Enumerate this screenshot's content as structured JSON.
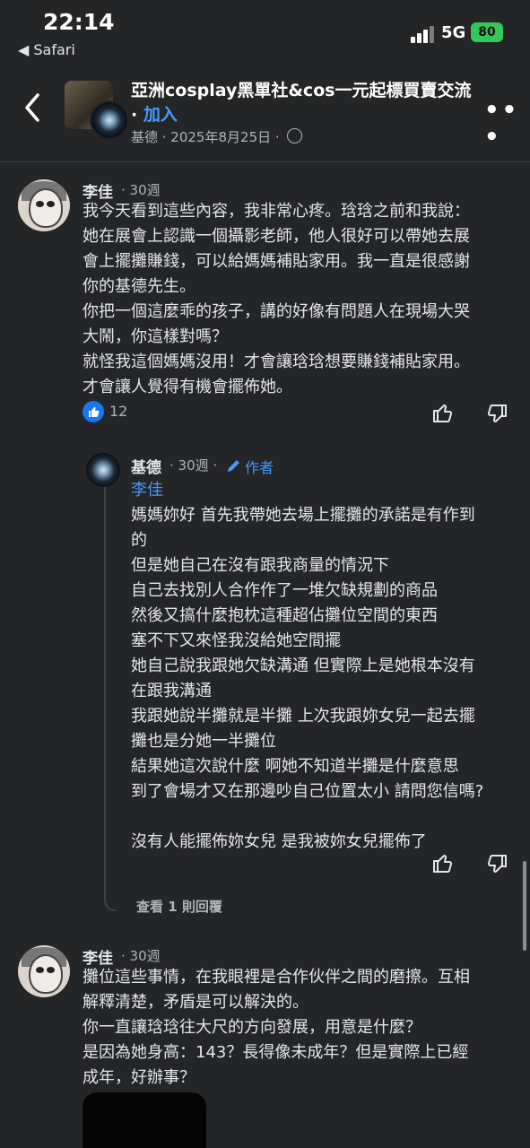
{
  "status": {
    "time": "22:14",
    "back_app": "◀ Safari",
    "network": "5G",
    "battery": "80"
  },
  "header": {
    "title": "亞洲cosplay黑單社&cos一元起標買賣交流",
    "separator": " · ",
    "join": "加入",
    "meta": "基德 · 2025年8月25日 · "
  },
  "comments": [
    {
      "name": "李佳",
      "time": "· 30週",
      "body": "我今天看到這些內容，我非常心疼。琀琀之前和我說：\n她在展會上認識一個攝影老師，他人很好可以帶她去展\n會上擺攤賺錢，可以給媽媽補貼家用。我一直是很感謝\n你的基德先生。\n你把一個這麼乖的孩子，講的好像有問題人在現場大哭\n大鬧，你這樣對嗎？\n就怪我這個媽媽沒用！才會讓琀琀想要賺錢補貼家用。\n才會讓人覺得有機會擺佈她。",
      "likes": "12"
    },
    {
      "name": "基德",
      "time": "· 30週 ·",
      "author_tag": "作者",
      "mention": "李佳",
      "body": "媽媽妳好 首先我帶她去場上擺攤的承諾是有作到\n的\n但是她自己在沒有跟我商量的情況下\n自己去找別人合作作了一堆欠缺規劃的商品\n然後又搞什麼抱枕這種超佔攤位空間的東西\n塞不下又來怪我沒給她空間擺\n她自己說我跟她欠缺溝通 但實際上是她根本沒有\n在跟我溝通\n我跟她說半攤就是半攤 上次我跟妳女兒一起去擺\n攤也是分她一半攤位\n結果她這次說什麼 啊她不知道半攤是什麼意思\n到了會場才又在那邊吵自己位置太小 請問您信嗎?\n\n沒有人能擺佈妳女兒 是我被妳女兒擺佈了"
    },
    {
      "name": "李佳",
      "time": "· 30週",
      "body": "攤位這些事情，在我眼裡是合作伙伴之間的磨擦。互相\n解釋清楚，矛盾是可以解決的。\n你一直讓琀琀往大尺的方向發展，用意是什麼？\n是因為她身高：143？長得像未成年？但是實際上已經\n成年，好辦事？"
    }
  ],
  "view_replies": "查看 1 則回覆"
}
